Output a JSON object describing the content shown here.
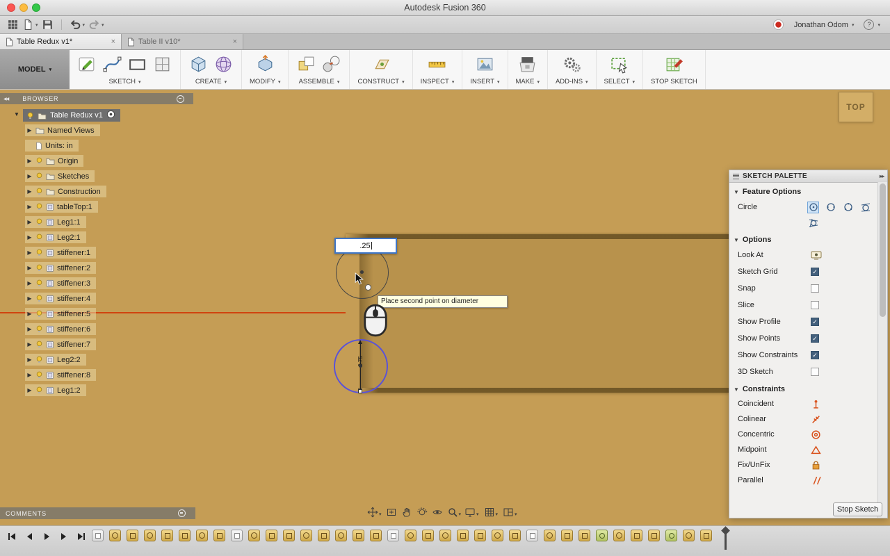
{
  "titlebar": {
    "title": "Autodesk Fusion 360"
  },
  "appbar": {
    "icons": [
      "app-grid",
      "file",
      "save",
      "undo",
      "redo"
    ],
    "user_name": "Jonathan Odom",
    "help_label": "?"
  },
  "tabs": [
    {
      "label": "Table Redux v1*",
      "active": true
    },
    {
      "label": "Table II v10*",
      "active": false
    }
  ],
  "ribbon": {
    "model_label": "MODEL",
    "groups": [
      {
        "label": "SKETCH",
        "caret": true,
        "icons": [
          "create-sketch",
          "spline",
          "rectangle",
          "project-geometry"
        ]
      },
      {
        "label": "CREATE",
        "caret": true,
        "icons": [
          "new-body",
          "form"
        ]
      },
      {
        "label": "MODIFY",
        "caret": true,
        "icons": [
          "press-pull"
        ]
      },
      {
        "label": "ASSEMBLE",
        "caret": true,
        "icons": [
          "new-component",
          "joint"
        ]
      },
      {
        "label": "CONSTRUCT",
        "caret": true,
        "icons": [
          "construction-plane"
        ]
      },
      {
        "label": "INSPECT",
        "caret": true,
        "icons": [
          "measure"
        ]
      },
      {
        "label": "INSERT",
        "caret": true,
        "icons": [
          "insert-canvas"
        ]
      },
      {
        "label": "MAKE",
        "caret": true,
        "icons": [
          "print-3d"
        ]
      },
      {
        "label": "ADD-INS",
        "caret": true,
        "icons": [
          "scripts-addins"
        ]
      },
      {
        "label": "SELECT",
        "caret": true,
        "icons": [
          "select-window"
        ]
      },
      {
        "label": "STOP SKETCH",
        "caret": false,
        "icons": [
          "stop-sketch"
        ]
      }
    ]
  },
  "browser": {
    "header": "BROWSER",
    "root": {
      "label": "Table Redux v1"
    },
    "items": [
      {
        "label": "Named Views",
        "icon": "folder",
        "bulb": false,
        "arrow": true
      },
      {
        "label": "Units: in",
        "icon": "document",
        "bulb": false,
        "arrow": false
      },
      {
        "label": "Origin",
        "icon": "folder",
        "bulb": true,
        "arrow": true
      },
      {
        "label": "Sketches",
        "icon": "folder",
        "bulb": true,
        "arrow": true
      },
      {
        "label": "Construction",
        "icon": "folder",
        "bulb": true,
        "arrow": true
      },
      {
        "label": "tableTop:1",
        "icon": "component",
        "bulb": true,
        "arrow": true
      },
      {
        "label": "Leg1:1",
        "icon": "component",
        "bulb": true,
        "arrow": true
      },
      {
        "label": "Leg2:1",
        "icon": "component",
        "bulb": true,
        "arrow": true
      },
      {
        "label": "stiffener:1",
        "icon": "component",
        "bulb": true,
        "arrow": true
      },
      {
        "label": "stiffener:2",
        "icon": "component",
        "bulb": true,
        "arrow": true
      },
      {
        "label": "stiffener:3",
        "icon": "component",
        "bulb": true,
        "arrow": true
      },
      {
        "label": "stiffener:4",
        "icon": "component",
        "bulb": true,
        "arrow": true
      },
      {
        "label": "stiffener:5",
        "icon": "component",
        "bulb": true,
        "arrow": true
      },
      {
        "label": "stiffener:6",
        "icon": "component",
        "bulb": true,
        "arrow": true
      },
      {
        "label": "stiffener:7",
        "icon": "component",
        "bulb": true,
        "arrow": true
      },
      {
        "label": "Leg2:2",
        "icon": "component",
        "bulb": true,
        "arrow": true
      },
      {
        "label": "stiffener:8",
        "icon": "component",
        "bulb": true,
        "arrow": true
      },
      {
        "label": "Leg1:2",
        "icon": "component",
        "bulb": true,
        "arrow": true
      }
    ]
  },
  "viewport": {
    "dimension_input": ".25",
    "tooltip": "Place second point on diameter",
    "view_cube_face": "TOP",
    "selected_circle_dimension": "0.75"
  },
  "palette": {
    "title": "SKETCH PALETTE",
    "feature_section": "Feature Options",
    "feature_row_label": "Circle",
    "feature_options": [
      {
        "name": "center-diameter-circle",
        "selected": true
      },
      {
        "name": "2-point-circle",
        "selected": false
      },
      {
        "name": "3-point-circle",
        "selected": false
      },
      {
        "name": "2-tangent-circle",
        "selected": false
      },
      {
        "name": "3-tangent-circle",
        "selected": false
      }
    ],
    "options_section": "Options",
    "options": [
      {
        "label": "Look At",
        "control": "look-at-button",
        "checked": false
      },
      {
        "label": "Sketch Grid",
        "control": "checkbox",
        "checked": true
      },
      {
        "label": "Snap",
        "control": "checkbox",
        "checked": false
      },
      {
        "label": "Slice",
        "control": "checkbox",
        "checked": false
      },
      {
        "label": "Show Profile",
        "control": "checkbox",
        "checked": true
      },
      {
        "label": "Show Points",
        "control": "checkbox",
        "checked": true
      },
      {
        "label": "Show Constraints",
        "control": "checkbox",
        "checked": true
      },
      {
        "label": "3D Sketch",
        "control": "checkbox",
        "checked": false
      }
    ],
    "constraints_section": "Constraints",
    "constraints": [
      {
        "label": "Coincident",
        "icon": "coincident"
      },
      {
        "label": "Colinear",
        "icon": "colinear"
      },
      {
        "label": "Concentric",
        "icon": "concentric"
      },
      {
        "label": "Midpoint",
        "icon": "midpoint"
      },
      {
        "label": "Fix/UnFix",
        "icon": "fix-unfix"
      },
      {
        "label": "Parallel",
        "icon": "parallel"
      }
    ],
    "stop_sketch_label": "Stop Sketch"
  },
  "comments": {
    "label": "COMMENTS"
  },
  "navbar": {
    "view_tools": [
      "position",
      "fit",
      "pan",
      "orbit",
      "look-at",
      "zoom"
    ],
    "display_tools": [
      "display-settings",
      "grid-and-snaps",
      "viewports"
    ]
  },
  "timeline": {
    "playback": [
      "go-to-start",
      "step-back",
      "play",
      "step-forward",
      "go-to-end"
    ],
    "items": [
      "component",
      "sketch",
      "extrude",
      "sketch",
      "extrude",
      "extrude",
      "sketch",
      "extrude",
      "component",
      "sketch",
      "extrude",
      "extrude",
      "sketch",
      "extrude",
      "sketch",
      "extrude",
      "extrude",
      "component",
      "sketch",
      "extrude",
      "sketch",
      "extrude",
      "extrude",
      "sketch",
      "extrude",
      "component",
      "sketch",
      "extrude",
      "extrude",
      "joint",
      "sketch",
      "extrude",
      "extrude",
      "joint",
      "sketch",
      "extrude"
    ]
  },
  "colors": {
    "canvas_wood": "#c59d55",
    "recess_wood": "#b8924c",
    "edge_shadow": "#6e5526",
    "selection_blue": "#5a52d8",
    "sketch_line_red": "#d0430f",
    "constraint_orange": "#d9531e"
  }
}
